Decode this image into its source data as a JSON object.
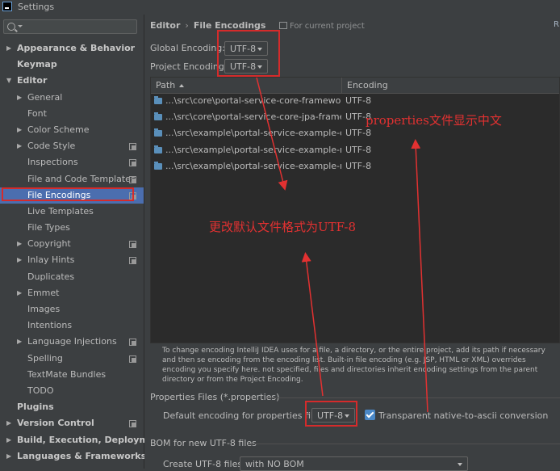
{
  "window": {
    "title": "Settings"
  },
  "search": {
    "placeholder": ""
  },
  "sidebar": {
    "items": [
      {
        "label": "Appearance & Behavior",
        "level": 0,
        "expand": "collapsed",
        "bold": true,
        "scope": false
      },
      {
        "label": "Keymap",
        "level": 0,
        "expand": "none",
        "bold": true,
        "scope": false
      },
      {
        "label": "Editor",
        "level": 0,
        "expand": "expanded",
        "bold": true,
        "scope": false
      },
      {
        "label": "General",
        "level": 1,
        "expand": "collapsed",
        "bold": false,
        "scope": false
      },
      {
        "label": "Font",
        "level": 1,
        "expand": "none",
        "bold": false,
        "scope": false
      },
      {
        "label": "Color Scheme",
        "level": 1,
        "expand": "collapsed",
        "bold": false,
        "scope": false
      },
      {
        "label": "Code Style",
        "level": 1,
        "expand": "collapsed",
        "bold": false,
        "scope": true
      },
      {
        "label": "Inspections",
        "level": 1,
        "expand": "none",
        "bold": false,
        "scope": true
      },
      {
        "label": "File and Code Templates",
        "level": 1,
        "expand": "none",
        "bold": false,
        "scope": true
      },
      {
        "label": "File Encodings",
        "level": 1,
        "expand": "none",
        "bold": false,
        "scope": true,
        "selected": true
      },
      {
        "label": "Live Templates",
        "level": 1,
        "expand": "none",
        "bold": false,
        "scope": false
      },
      {
        "label": "File Types",
        "level": 1,
        "expand": "none",
        "bold": false,
        "scope": false
      },
      {
        "label": "Copyright",
        "level": 1,
        "expand": "collapsed",
        "bold": false,
        "scope": true
      },
      {
        "label": "Inlay Hints",
        "level": 1,
        "expand": "collapsed",
        "bold": false,
        "scope": true
      },
      {
        "label": "Duplicates",
        "level": 1,
        "expand": "none",
        "bold": false,
        "scope": false
      },
      {
        "label": "Emmet",
        "level": 1,
        "expand": "collapsed",
        "bold": false,
        "scope": false
      },
      {
        "label": "Images",
        "level": 1,
        "expand": "none",
        "bold": false,
        "scope": false
      },
      {
        "label": "Intentions",
        "level": 1,
        "expand": "none",
        "bold": false,
        "scope": false
      },
      {
        "label": "Language Injections",
        "level": 1,
        "expand": "collapsed",
        "bold": false,
        "scope": true
      },
      {
        "label": "Spelling",
        "level": 1,
        "expand": "none",
        "bold": false,
        "scope": true
      },
      {
        "label": "TextMate Bundles",
        "level": 1,
        "expand": "none",
        "bold": false,
        "scope": false
      },
      {
        "label": "TODO",
        "level": 1,
        "expand": "none",
        "bold": false,
        "scope": false
      },
      {
        "label": "Plugins",
        "level": 0,
        "expand": "none",
        "bold": true,
        "scope": false
      },
      {
        "label": "Version Control",
        "level": 0,
        "expand": "collapsed",
        "bold": true,
        "scope": true
      },
      {
        "label": "Build, Execution, Deployment",
        "level": 0,
        "expand": "collapsed",
        "bold": true,
        "scope": false
      },
      {
        "label": "Languages & Frameworks",
        "level": 0,
        "expand": "collapsed",
        "bold": true,
        "scope": false
      }
    ]
  },
  "main": {
    "breadcrumb": [
      "Editor",
      "File Encodings"
    ],
    "for_project": "For current project",
    "reset_link": "R",
    "global_encoding": {
      "label": "Global Encoding:",
      "value": "UTF-8"
    },
    "project_encoding": {
      "label": "Project Encoding:",
      "value": "UTF-8"
    },
    "table": {
      "columns": [
        "Path",
        "Encoding"
      ],
      "rows": [
        {
          "path": "...\\src\\core\\portal-service-core-framework\\src",
          "encoding": "UTF-8"
        },
        {
          "path": "...\\src\\core\\portal-service-core-jpa-framework",
          "encoding": "UTF-8"
        },
        {
          "path": "...\\src\\example\\portal-service-example-core\\s",
          "encoding": "UTF-8"
        },
        {
          "path": "...\\src\\example\\portal-service-example-multipl",
          "encoding": "UTF-8"
        },
        {
          "path": "...\\src\\example\\portal-service-example-no-dat",
          "encoding": "UTF-8"
        }
      ]
    },
    "description": "To change encoding IntelliJ IDEA uses for a file, a directory, or the entire project, add its path if necessary and then se encoding from the encoding list. Built-in file encoding (e.g. JSP, HTML or XML) overrides encoding you specify here. not specified, files and directories inherit encoding settings from the parent directory or from the Project Encoding.",
    "properties_section": "Properties Files (*.properties)",
    "default_props_label": "Default encoding for properties files:",
    "default_props_value": "UTF-8",
    "transparent_label": "Transparent native-to-ascii conversion",
    "transparent_checked": true,
    "bom_section": "BOM for new UTF-8 files",
    "create_bom_label": "Create UTF-8 files:",
    "create_bom_value": "with NO BOM"
  },
  "annotations": {
    "change_default": "更改默认文件格式为UTF-8",
    "properties_cn": "properties文件显示中文",
    "color": "#e23131"
  },
  "colors": {
    "background": "#3c3f41",
    "table_bg": "#2b2b2b",
    "selection": "#4b6eaf",
    "highlight_box": "#d52b2b",
    "folder": "#5a8fba",
    "checkbox": "#4a88c7"
  }
}
